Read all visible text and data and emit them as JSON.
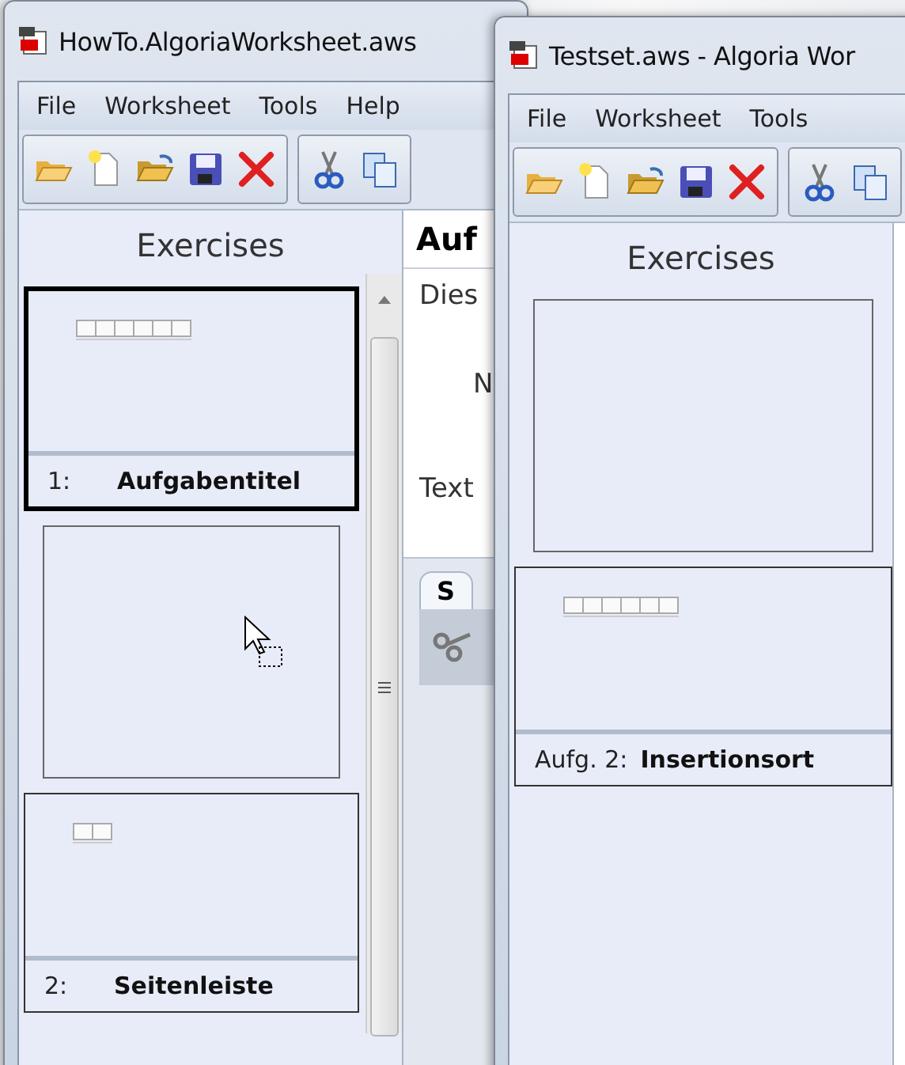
{
  "windows": [
    {
      "title": "HowTo.AlgoriaWorksheet.aws",
      "menu": [
        "File",
        "Worksheet",
        "Tools",
        "Help"
      ],
      "sidebar": {
        "title": "Exercises",
        "scrollable": true,
        "items": [
          {
            "kind": "exercise",
            "number": "1:",
            "title": "Aufgabentitel",
            "preview": {
              "kind": "long-array"
            },
            "selected": true
          },
          {
            "kind": "placeholder",
            "drag_cursor": true
          },
          {
            "kind": "exercise",
            "number": "2:",
            "title": "Seitenleiste",
            "preview": {
              "kind": "short-array"
            },
            "selected": false
          }
        ]
      },
      "content": {
        "heading": "Auf",
        "lines": [
          "Dies",
          "N",
          "Text"
        ],
        "tab": "S"
      }
    },
    {
      "title": "Testset.aws - Algoria Wor",
      "menu": [
        "File",
        "Worksheet",
        "Tools"
      ],
      "sidebar": {
        "title": "Exercises",
        "scrollable": false,
        "items": [
          {
            "kind": "placeholder",
            "drag_cursor": false
          },
          {
            "kind": "exercise",
            "number": "Aufg. 2:",
            "title": "Insertionsort",
            "preview": {
              "kind": "long-array"
            },
            "selected": false
          }
        ]
      }
    }
  ]
}
